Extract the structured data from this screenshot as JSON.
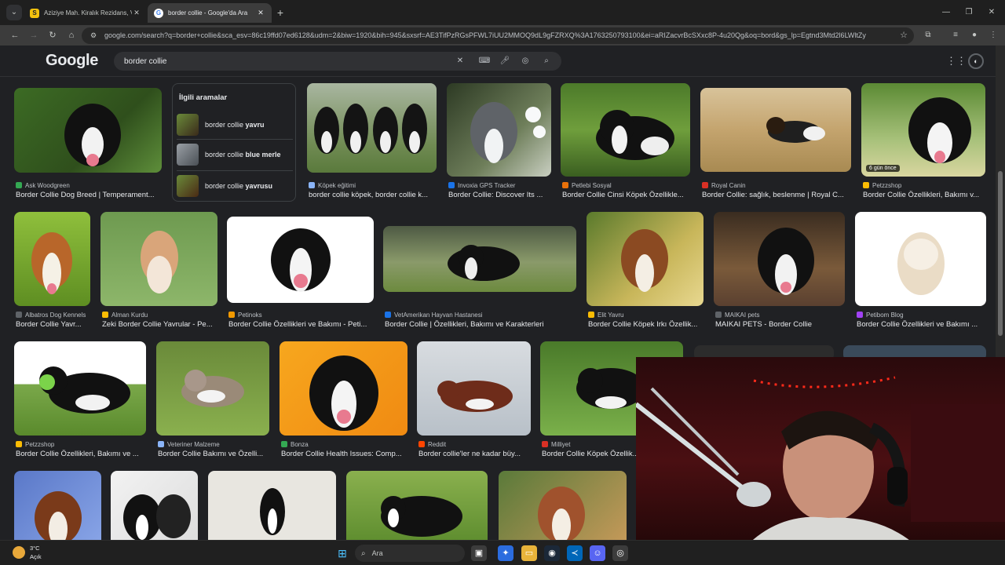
{
  "browser": {
    "tabs": [
      {
        "title": "Aziziye Mah. Kiralık Rezidans, Villa",
        "favicon": "yellow-s-favicon"
      },
      {
        "title": "border collie - Google'da Ara",
        "favicon": "google-favicon"
      }
    ],
    "url": "google.com/search?q=border+collie&sca_esv=86c19ffd07ed6128&udm=2&biw=1920&bih=945&sxsrf=AE3TifPzRGsPFWL7iUU2MMOQ9dL9gFZRXQ%3A1763250793100&ei=aRIZacvrBcSXxc8P-4u20Qg&oq=bord&gs_lp=Egtnd3Mtd2l6LWltZy"
  },
  "google": {
    "logo": "Google",
    "query": "border collie"
  },
  "related": {
    "title": "İlgili aramalar",
    "items": [
      {
        "prefix": "border collie ",
        "bold": "yavru"
      },
      {
        "prefix": "border collie ",
        "bold": "blue merle"
      },
      {
        "prefix": "border collie ",
        "bold": "yavrusu"
      }
    ]
  },
  "results": {
    "row1": [
      {
        "source": "Ask Woodgreen",
        "title": "Border Collie Dog Breed | Temperament..."
      },
      {
        "source": "Köpek eğitimi",
        "title": "border collie köpek, border collie k..."
      },
      {
        "source": "Invoxia GPS Tracker",
        "title": "Border Collie: Discover Its ..."
      },
      {
        "source": "Petlebi Sosyal",
        "title": "Border Collie Cinsi Köpek Özellikle..."
      },
      {
        "source": "Royal Canin",
        "title": "Border Collie: sağlık, beslenme | Royal C..."
      },
      {
        "source": "Petzzshop",
        "title": "Border Collie Özellikleri, Bakımı v...",
        "badge": "6 gün önce"
      }
    ],
    "row2": [
      {
        "source": "Albatros Dog Kennels",
        "title": "Border Collie Yavr..."
      },
      {
        "source": "Alman Kurdu",
        "title": "Zeki Border Collie Yavrular - Pe..."
      },
      {
        "source": "Petinoks",
        "title": "Border Collie Özellikleri ve Bakımı - Peti..."
      },
      {
        "source": "VetAmerikan Hayvan Hastanesi",
        "title": "Border Collie | Özellikleri, Bakımı ve Karakterleri"
      },
      {
        "source": "Elit Yavru",
        "title": "Border Collie Köpek Irkı Özellik..."
      },
      {
        "source": "MAIKAI pets",
        "title": "MAIKAI PETS - Border Collie"
      },
      {
        "source": "Petibom Blog",
        "title": "Border Collie Özellikleri ve Bakımı ..."
      }
    ],
    "row3": [
      {
        "source": "Petzzshop",
        "title": "Border Collie Özellikleri, Bakımı ve ..."
      },
      {
        "source": "Veteriner Malzeme",
        "title": "Border Collie Bakımı ve Özelli..."
      },
      {
        "source": "Bonza",
        "title": "Border Collie Health Issues: Comp..."
      },
      {
        "source": "Reddit",
        "title": "Border collie'ler ne kadar büy..."
      },
      {
        "source": "Milliyet",
        "title": "Border Collie Köpek Özellik..."
      }
    ]
  },
  "taskbar": {
    "temperature": "3°C",
    "condition": "Açık",
    "search_placeholder": "Ara"
  }
}
